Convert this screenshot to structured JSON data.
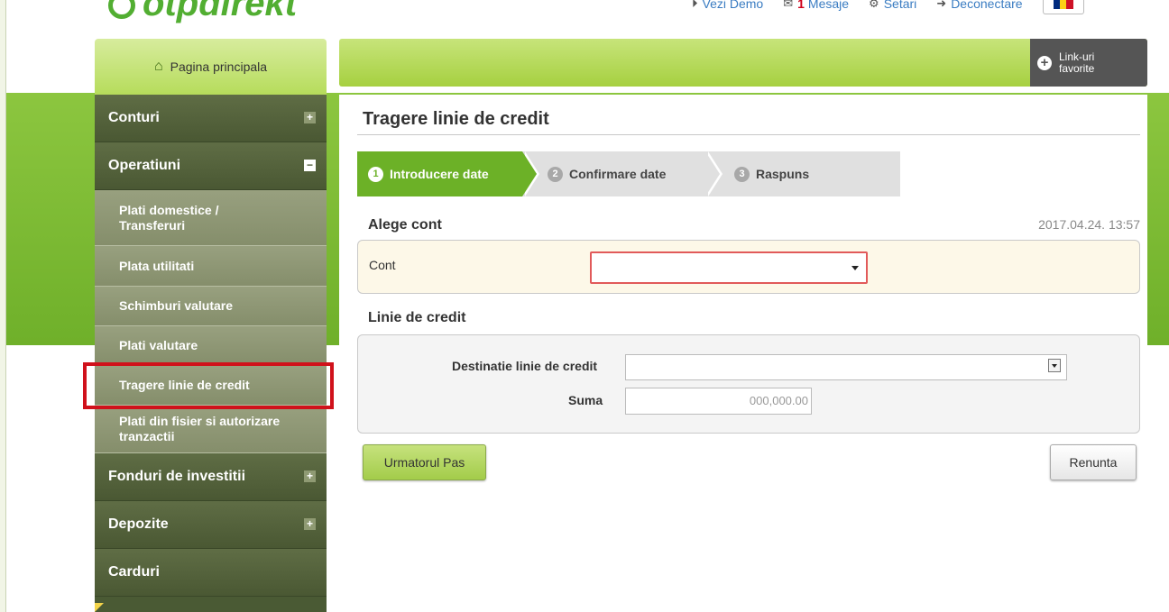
{
  "brand": {
    "logo_text": "otpdirekt"
  },
  "top_links": {
    "demo": "Vezi Demo",
    "messages_count": "1",
    "messages": "Mesaje",
    "settings": "Setari",
    "logout": "Deconectare"
  },
  "home_tab": {
    "label": "Pagina principala"
  },
  "favorites": {
    "label_line1": "Link-uri",
    "label_line2": "favorite"
  },
  "sidebar": {
    "items": [
      {
        "label": "Conturi"
      },
      {
        "label": "Operatiuni"
      },
      {
        "label": "Plati domestice / Transferuri"
      },
      {
        "label": "Plata utilitati"
      },
      {
        "label": "Schimburi valutare"
      },
      {
        "label": "Plati valutare"
      },
      {
        "label": "Tragere linie de credit"
      },
      {
        "label": "Plati din fisier si autorizare tranzactii"
      },
      {
        "label": "Fonduri de investitii"
      },
      {
        "label": "Depozite"
      },
      {
        "label": "Carduri"
      }
    ],
    "toggle_plus": "+",
    "toggle_minus": "−"
  },
  "page": {
    "title": "Tragere linie de credit",
    "timestamp": "2017.04.24. 13:57"
  },
  "steps": [
    {
      "num": "1",
      "label": "Introducere date"
    },
    {
      "num": "2",
      "label": "Confirmare date"
    },
    {
      "num": "3",
      "label": "Raspuns"
    }
  ],
  "account_section": {
    "title": "Alege cont",
    "field_label": "Cont",
    "selected": ""
  },
  "credit_section": {
    "title": "Linie de credit",
    "destination_label": "Destinatie linie de credit",
    "destination_value": "",
    "amount_label": "Suma",
    "amount_placeholder": "000,000.00"
  },
  "buttons": {
    "next": "Urmatorul Pas",
    "cancel": "Renunta"
  },
  "colors": {
    "brand_green": "#52ae32",
    "active_step": "#6cb127",
    "sidebar_dark": "#4a5833",
    "highlight": "#d0111b"
  }
}
